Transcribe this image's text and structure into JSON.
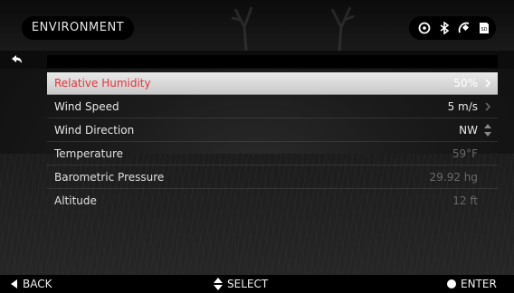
{
  "header": {
    "title": "ENVIRONMENT",
    "status_icons": [
      "scope-icon",
      "bluetooth-icon",
      "satellite-icon",
      "sd-card-icon"
    ]
  },
  "settings": [
    {
      "label": "Relative Humidity",
      "value": "50%",
      "state": "selected"
    },
    {
      "label": "Wind Speed",
      "value": "5 m/s",
      "state": "enabled"
    },
    {
      "label": "Wind Direction",
      "value": "NW",
      "state": "enabled"
    },
    {
      "label": "Temperature",
      "value": "59°F",
      "state": "disabled"
    },
    {
      "label": "Barometric Pressure",
      "value": "29.92 hg",
      "state": "disabled"
    },
    {
      "label": "Altitude",
      "value": "12 ft",
      "state": "disabled"
    }
  ],
  "footer": {
    "back_label": "BACK",
    "select_label": "SELECT",
    "enter_label": "ENTER"
  },
  "colors": {
    "selected_label": "#e5333a",
    "disabled_value": "#6a6a6a"
  }
}
